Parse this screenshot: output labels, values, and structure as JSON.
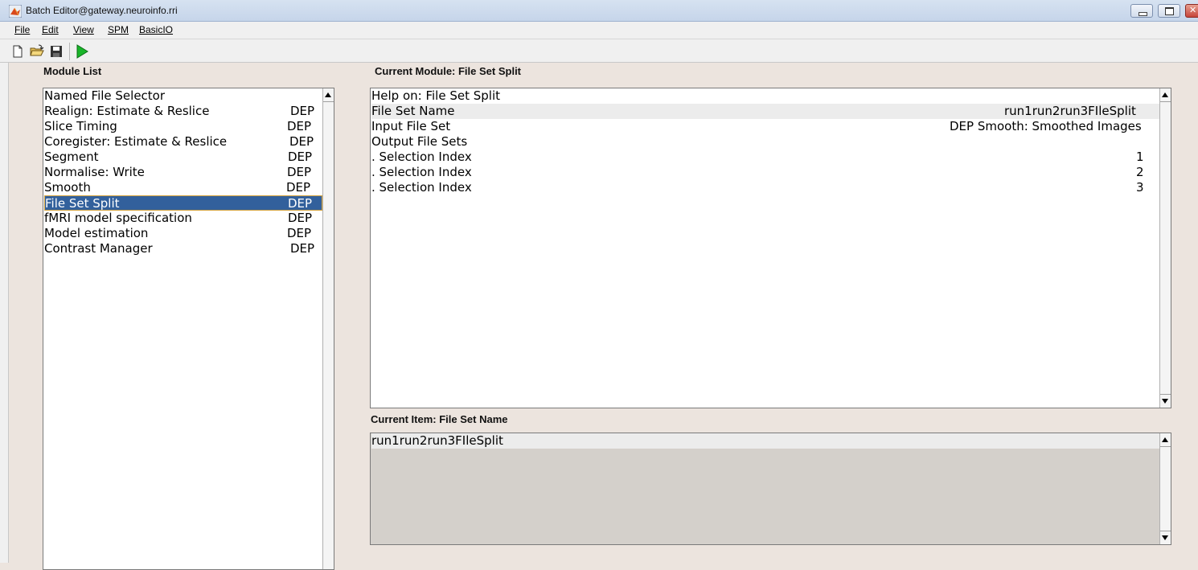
{
  "window": {
    "title": "Batch Editor@gateway.neuroinfo.rri"
  },
  "menu": [
    "File",
    "Edit",
    "View",
    "SPM",
    "BasicIO"
  ],
  "toolbar": {
    "icons": [
      "new-file-icon",
      "open-folder-icon",
      "save-icon",
      "run-icon"
    ],
    "run_color": "#19b52a"
  },
  "module_list": {
    "label": "Module List",
    "items": [
      {
        "name": "Named File Selector",
        "dep": ""
      },
      {
        "name": "Realign: Estimate & Reslice",
        "dep": "DEP"
      },
      {
        "name": "Slice Timing",
        "dep": "DEP"
      },
      {
        "name": "Coregister: Estimate & Reslice",
        "dep": "DEP"
      },
      {
        "name": "Segment",
        "dep": "DEP"
      },
      {
        "name": "Normalise: Write",
        "dep": "DEP"
      },
      {
        "name": "Smooth",
        "dep": "DEP"
      },
      {
        "name": "File Set Split",
        "dep": "DEP",
        "selected": true
      },
      {
        "name": "fMRI model specification",
        "dep": "DEP"
      },
      {
        "name": "Model estimation",
        "dep": "DEP"
      },
      {
        "name": "Contrast Manager",
        "dep": "DEP"
      }
    ],
    "selected_color": "#32609c"
  },
  "current_module": {
    "label": "Current Module: File Set Split",
    "rows": [
      {
        "name": "Help on: File Set Split",
        "value": ""
      },
      {
        "name": "File Set Name",
        "value": "run1run2run3FIleSplit"
      },
      {
        "name": "Input File Set",
        "value": "DEP Smooth: Smoothed Images"
      },
      {
        "name": "Output File Sets",
        "value": ""
      },
      {
        "name": ". Selection Index",
        "value": "1"
      },
      {
        "name": ". Selection Index",
        "value": "2"
      },
      {
        "name": ". Selection Index",
        "value": "3"
      }
    ]
  },
  "current_item": {
    "label": "Current Item: File Set Name",
    "value": "run1run2run3FIleSplit"
  }
}
